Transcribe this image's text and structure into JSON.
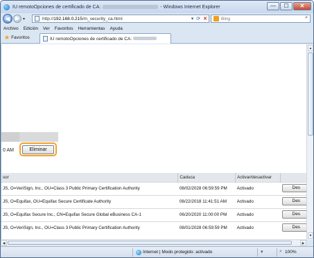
{
  "window": {
    "title_prefix": "IU remotoOpciones de certificado de CA:",
    "title_suffix": "- Windows Internet Explorer",
    "controls": {
      "minimize": "—",
      "maximize": "☐",
      "close": "✕"
    }
  },
  "address_bar": {
    "url_prefix": "http://",
    "url_host": "192.168.0.215",
    "url_path": "/m_security_ca.html",
    "refresh": "⟳",
    "stop": "✕",
    "dropdown": "▾"
  },
  "search": {
    "placeholder": "Bing",
    "go": "⌕"
  },
  "menu": [
    "Archivo",
    "Edición",
    "Ver",
    "Favoritos",
    "Herramientas",
    "Ayuda"
  ],
  "favorites": {
    "label": "Favoritos"
  },
  "tab": {
    "title": "IU remotoOpciones de certificado de CA:"
  },
  "content": {
    "time_fragment": "0 AM",
    "delete_button": "Eliminar",
    "table": {
      "headers": [
        "sor",
        "Caduca",
        "Activar/desactivar",
        ""
      ],
      "rows": [
        {
          "issuer": "JS, O=VeriSign, Inc., OU=Class 3 Public Primary Certification Authority",
          "expires": "08/02/2028 06:59:59 PM",
          "status": "Activado",
          "action": "Des"
        },
        {
          "issuer": "JS, O=Equifax, OU=Equifax Secure Certificate Authority",
          "expires": "08/22/2018 11:41:51 AM",
          "status": "Activado",
          "action": "Des"
        },
        {
          "issuer": "JS, O=Equifax Secure Inc., CN=Equifax Secure Global eBusiness CA-1",
          "expires": "06/20/2020 11:00:00 PM",
          "status": "Activado",
          "action": "Des"
        },
        {
          "issuer": "JS, O=VeriSign, Inc., OU=Class 3 Public Primary Certification Authority",
          "expires": "08/01/2028 06:59:59 PM",
          "status": "Activado",
          "action": "Des"
        }
      ]
    }
  },
  "status_bar": {
    "zone": "Internet | Modo protegido: activado",
    "zoom": "100%"
  }
}
